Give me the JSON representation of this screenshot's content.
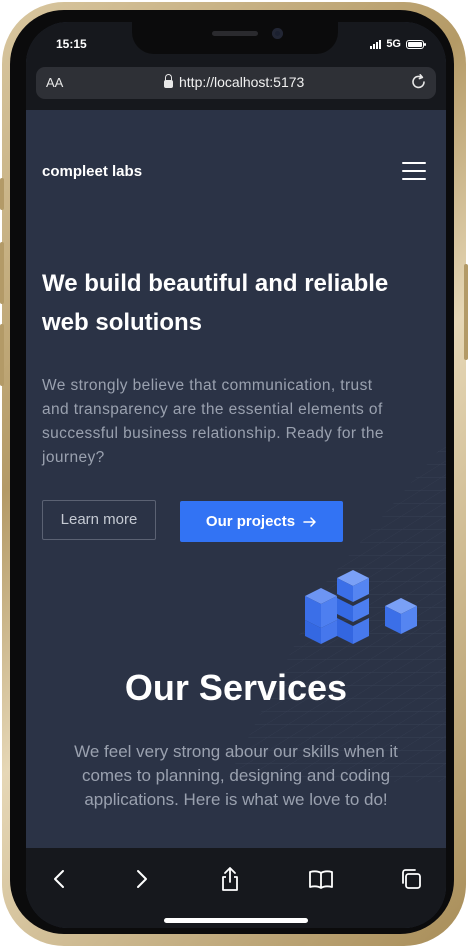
{
  "status": {
    "time": "15:15",
    "network": "5G"
  },
  "browser": {
    "text_size_label": "AA",
    "url": "http://localhost:5173"
  },
  "site": {
    "logo": "compleet labs",
    "hero_title": "We build beautiful and reliable web solutions",
    "hero_text": "We strongly believe that communication, trust and transparency are the essential elements of successful business relationship. Ready for the journey?",
    "btn_learn_more": "Learn more",
    "btn_our_projects": "Our projects",
    "services_title": "Our Services",
    "services_text": "We feel very strong abour our skills when it comes to planning, designing and coding applications. Here is what we love to do!"
  },
  "colors": {
    "page_bg": "#2b3346",
    "accent": "#3273f4",
    "muted_text": "#9aa1af",
    "browser_chrome": "#16181d"
  },
  "icons": {
    "url_lock": "lock-icon",
    "reload": "reload-icon",
    "menu": "hamburger-menu-icon",
    "cta_arrow": "arrow-right-icon",
    "toolbar": [
      "back-icon",
      "forward-icon",
      "share-icon",
      "bookmarks-icon",
      "tabs-icon"
    ]
  }
}
